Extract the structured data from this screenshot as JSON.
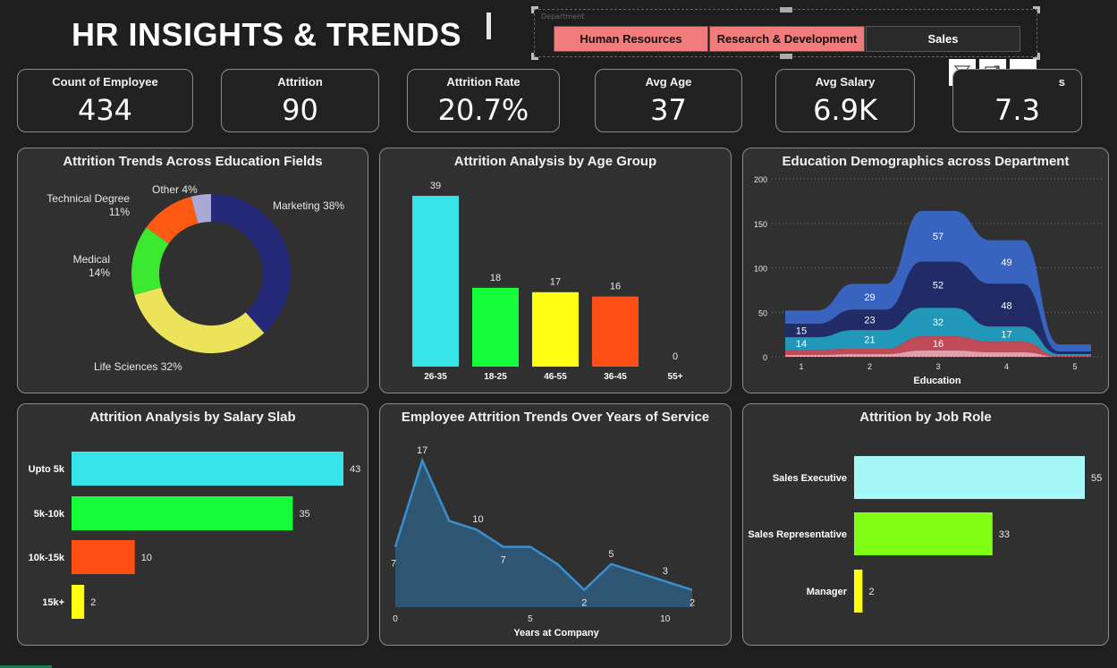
{
  "title": "HR INSIGHTS & TRENDS",
  "slicer": {
    "label": "Department",
    "options": [
      {
        "label": "Human Resources",
        "selected": true
      },
      {
        "label": "Research & Development",
        "selected": true
      },
      {
        "label": "Sales",
        "selected": false
      }
    ]
  },
  "toolbar": {
    "filter_icon": "filter-icon",
    "focus_icon": "focus-mode-icon",
    "more_icon": "more-options-icon",
    "more_label": "···"
  },
  "kpis": [
    {
      "label": "Count of Employee",
      "value": "434"
    },
    {
      "label": "Attrition",
      "value": "90"
    },
    {
      "label": "Attrition Rate",
      "value": "20.7%"
    },
    {
      "label": "Avg Age",
      "value": "37"
    },
    {
      "label": "Avg Salary",
      "value": "6.9K"
    },
    {
      "label": "s",
      "value": "7.3"
    }
  ],
  "colors": {
    "selected": "#f07c7c",
    "cyan": "#35e3e8",
    "green": "#14ff3a",
    "yellow": "#ffff14",
    "orange": "#ff4f14",
    "navy": "#252a78",
    "lavender": "#a9a9d6"
  },
  "chart_data": [
    {
      "type": "pie",
      "title": "Attrition Trends Across Education Fields",
      "slices": [
        {
          "label": "Marketing",
          "value": 38,
          "display": "Marketing 38%",
          "color": "#252a78"
        },
        {
          "label": "Life Sciences",
          "value": 32,
          "display": "Life Sciences 32%",
          "color": "#ebe35a"
        },
        {
          "label": "Medical",
          "value": 14,
          "display": "Medical\n14%",
          "color": "#3ce830"
        },
        {
          "label": "Technical Degree",
          "value": 11,
          "display": "Technical Degree\n11%",
          "color": "#ff5a14"
        },
        {
          "label": "Other",
          "value": 4,
          "display": "Other 4%",
          "color": "#a9a9d6"
        }
      ]
    },
    {
      "type": "bar",
      "title": "Attrition Analysis by Age Group",
      "categories": [
        "26-35",
        "18-25",
        "46-55",
        "36-45",
        "55+"
      ],
      "values": [
        39,
        18,
        17,
        16,
        0
      ],
      "colors": [
        "#35e3e8",
        "#14ff3a",
        "#ffff14",
        "#ff4f14",
        "#ffffff"
      ],
      "ylim": [
        0,
        39
      ]
    },
    {
      "type": "area",
      "title": "Education Demographics across Department",
      "xlabel": "Education",
      "ylabel": "",
      "x": [
        1,
        2,
        3,
        4,
        5
      ],
      "y_ticks": [
        0,
        50,
        100,
        150,
        200
      ],
      "ylim": [
        0,
        200
      ],
      "series": [
        {
          "values": [
            2,
            3,
            7,
            5,
            0
          ],
          "color": "#ffb3c0",
          "labels": [
            "",
            "",
            "",
            "",
            ""
          ]
        },
        {
          "values": [
            6,
            6,
            16,
            12,
            1
          ],
          "color": "#d85060",
          "labels": [
            "",
            "",
            "16",
            "",
            ""
          ]
        },
        {
          "values": [
            14,
            21,
            32,
            17,
            2
          ],
          "color": "#1fa9d1",
          "labels": [
            "14",
            "21",
            "32",
            "17",
            ""
          ]
        },
        {
          "values": [
            15,
            23,
            52,
            48,
            3
          ],
          "color": "#1e2a70",
          "labels": [
            "15",
            "23",
            "52",
            "48",
            ""
          ]
        },
        {
          "values": [
            15,
            29,
            57,
            49,
            8
          ],
          "color": "#3a6dd8",
          "labels": [
            "",
            "29",
            "57",
            "49",
            ""
          ]
        }
      ]
    },
    {
      "type": "bar",
      "title": "Attrition Analysis by Salary Slab",
      "orientation": "horizontal",
      "categories": [
        "Upto 5k",
        "5k-10k",
        "10k-15k",
        "15k+"
      ],
      "values": [
        43,
        35,
        10,
        2
      ],
      "colors": [
        "#35e3e8",
        "#14ff3a",
        "#ff4f14",
        "#ffff14"
      ],
      "xlim": [
        0,
        43
      ]
    },
    {
      "type": "area",
      "title": "Employee Attrition Trends Over Years of Service",
      "xlabel": "Years at Company",
      "x": [
        0,
        1,
        2,
        3,
        4,
        5,
        6,
        7,
        8,
        9,
        10,
        11
      ],
      "values": [
        7,
        17,
        10,
        9,
        7,
        7,
        5,
        2,
        5,
        4,
        3,
        2
      ],
      "labels": [
        "7",
        "17",
        "",
        "10",
        "7",
        "",
        "",
        "2",
        "5",
        "",
        "3",
        "2"
      ],
      "x_ticks": [
        0,
        5,
        10
      ],
      "xlim": [
        0,
        11
      ],
      "ylim": [
        0,
        17
      ]
    },
    {
      "type": "bar",
      "title": "Attrition by Job Role",
      "orientation": "horizontal",
      "categories": [
        "Sales Executive",
        "Sales Representative",
        "Manager"
      ],
      "values": [
        55,
        33,
        2
      ],
      "colors": [
        "#a6f8f8",
        "#80ff14",
        "#ffff14"
      ],
      "xlim": [
        0,
        55
      ]
    }
  ]
}
